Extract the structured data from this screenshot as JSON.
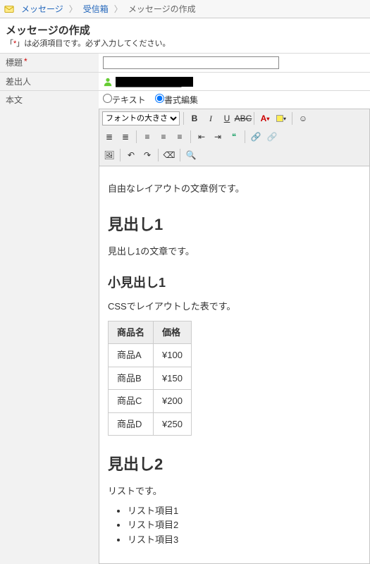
{
  "breadcrumb": {
    "items": [
      {
        "label": "メッセージ",
        "link": true
      },
      {
        "label": "受信箱",
        "link": true
      },
      {
        "label": "メッセージの作成",
        "link": false
      }
    ]
  },
  "page": {
    "title": "メッセージの作成",
    "required_prefix": "「",
    "required_mark": "*",
    "required_suffix": "」は必須項目です。必ず入力してください。"
  },
  "labels": {
    "subject": "標題",
    "from": "差出人",
    "body": "本文"
  },
  "subject": {
    "value": ""
  },
  "sender": {
    "name": "███████████"
  },
  "format": {
    "text_label": "テキスト",
    "rich_label": "書式編集",
    "selected": "rich"
  },
  "toolbar": {
    "font_size_label": "フォントの大きさ"
  },
  "content": {
    "intro": "自由なレイアウトの文章例です。",
    "h1_1": "見出し1",
    "h1_1_text": "見出し1の文章です。",
    "h2_1": "小見出し1",
    "h2_1_text": "CSSでレイアウトした表です。",
    "table": {
      "headers": [
        "商品名",
        "価格"
      ],
      "rows": [
        [
          "商品A",
          "¥100"
        ],
        [
          "商品B",
          "¥150"
        ],
        [
          "商品C",
          "¥200"
        ],
        [
          "商品D",
          "¥250"
        ]
      ]
    },
    "h1_2": "見出し2",
    "h1_2_text": "リストです。",
    "list": [
      "リスト項目1",
      "リスト項目2",
      "リスト項目3"
    ]
  }
}
